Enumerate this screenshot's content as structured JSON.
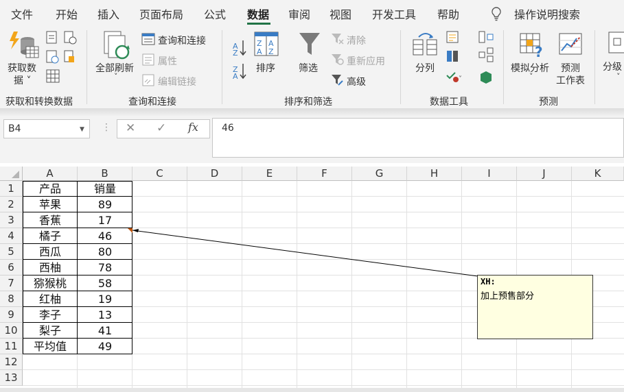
{
  "menu": {
    "items": [
      "文件",
      "开始",
      "插入",
      "页面布局",
      "公式",
      "数据",
      "审阅",
      "视图",
      "开发工具",
      "帮助"
    ],
    "active": "数据",
    "tell_me": "操作说明搜索"
  },
  "ribbon": {
    "get_data": {
      "label_line1": "获取数",
      "label_line2": "据 ˅"
    },
    "group_get_transform": "获取和转换数据",
    "refresh_all": {
      "label": "全部刷新",
      "arrow": "˅"
    },
    "queries_connections": "查询和连接",
    "properties": "属性",
    "edit_links": "编辑链接",
    "group_queries": "查询和连接",
    "sort": "排序",
    "filter": "筛选",
    "clear": "清除",
    "reapply": "重新应用",
    "advanced": "高级",
    "group_sort_filter": "排序和筛选",
    "text_to_columns": "分列",
    "group_data_tools": "数据工具",
    "what_if": {
      "label": "模拟分析",
      "arrow": "˅"
    },
    "forecast_sheet": {
      "line1": "预测",
      "line2": "工作表"
    },
    "group_forecast": "预测",
    "outline": {
      "label": "分级",
      "arrow": "˅"
    }
  },
  "formula_bar": {
    "name_box": "B4",
    "cancel": "✕",
    "enter": "✓",
    "fx": "fx",
    "value": "46"
  },
  "sheet": {
    "columns": [
      "A",
      "B",
      "C",
      "D",
      "E",
      "F",
      "G",
      "H",
      "I",
      "J",
      "K"
    ],
    "rows": [
      "1",
      "2",
      "3",
      "4",
      "5",
      "6",
      "7",
      "8",
      "9",
      "10",
      "11",
      "12",
      "13"
    ],
    "table": [
      [
        "产品",
        "销量"
      ],
      [
        "苹果",
        "89"
      ],
      [
        "香蕉",
        "17"
      ],
      [
        "橘子",
        "46"
      ],
      [
        "西瓜",
        "80"
      ],
      [
        "西柚",
        "78"
      ],
      [
        "猕猴桃",
        "58"
      ],
      [
        "红柚",
        "19"
      ],
      [
        "李子",
        "13"
      ],
      [
        "梨子",
        "41"
      ],
      [
        "平均值",
        "49"
      ]
    ]
  },
  "comment": {
    "author": "XH:",
    "text": "加上预售部分"
  }
}
